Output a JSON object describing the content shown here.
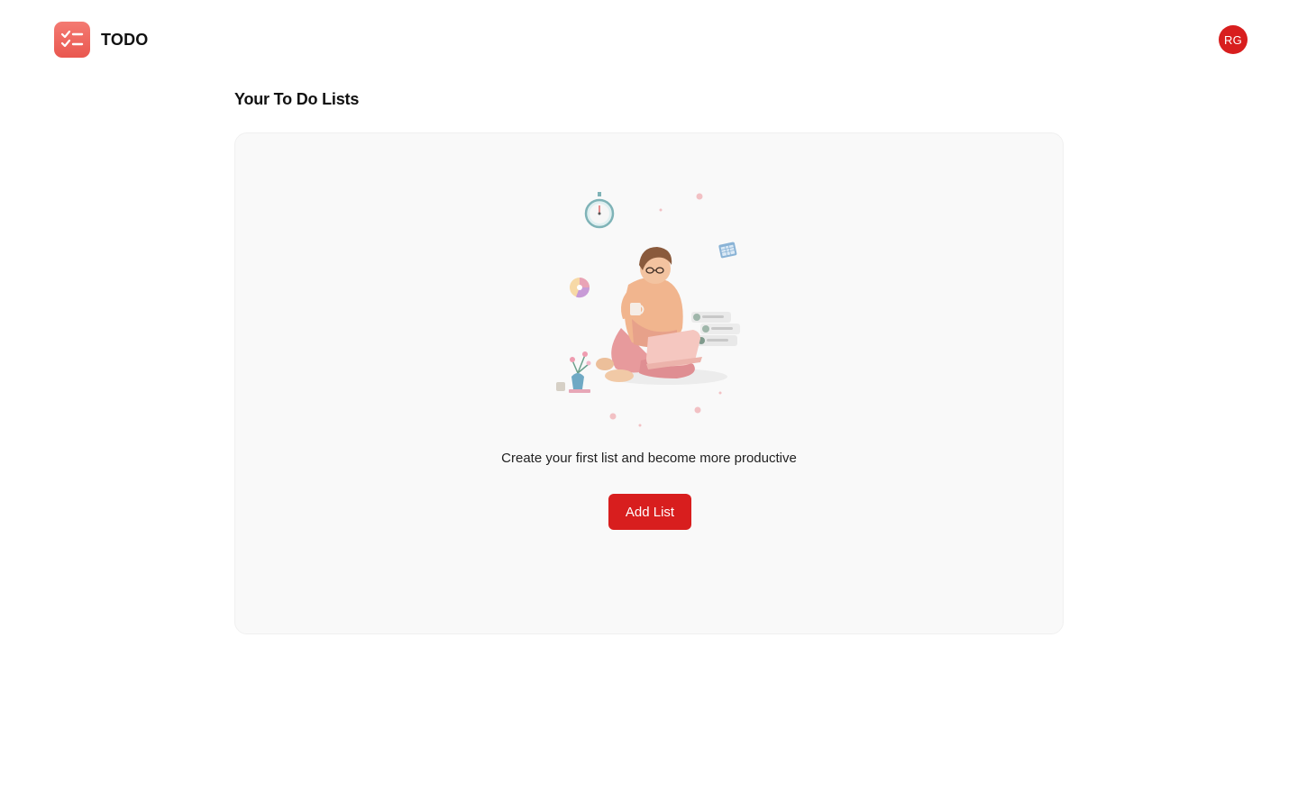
{
  "app": {
    "name": "TODO",
    "logo_icon": "checklist-icon",
    "brand_color": "#e9574f"
  },
  "user": {
    "initials": "RG",
    "avatar_color": "#d81e1e"
  },
  "main": {
    "title": "Your To Do Lists",
    "empty_state": {
      "illustration": "person-with-laptop-illustration",
      "message": "Create your first list and become more productive",
      "button_label": "Add List",
      "button_color": "#d81e1e"
    }
  }
}
